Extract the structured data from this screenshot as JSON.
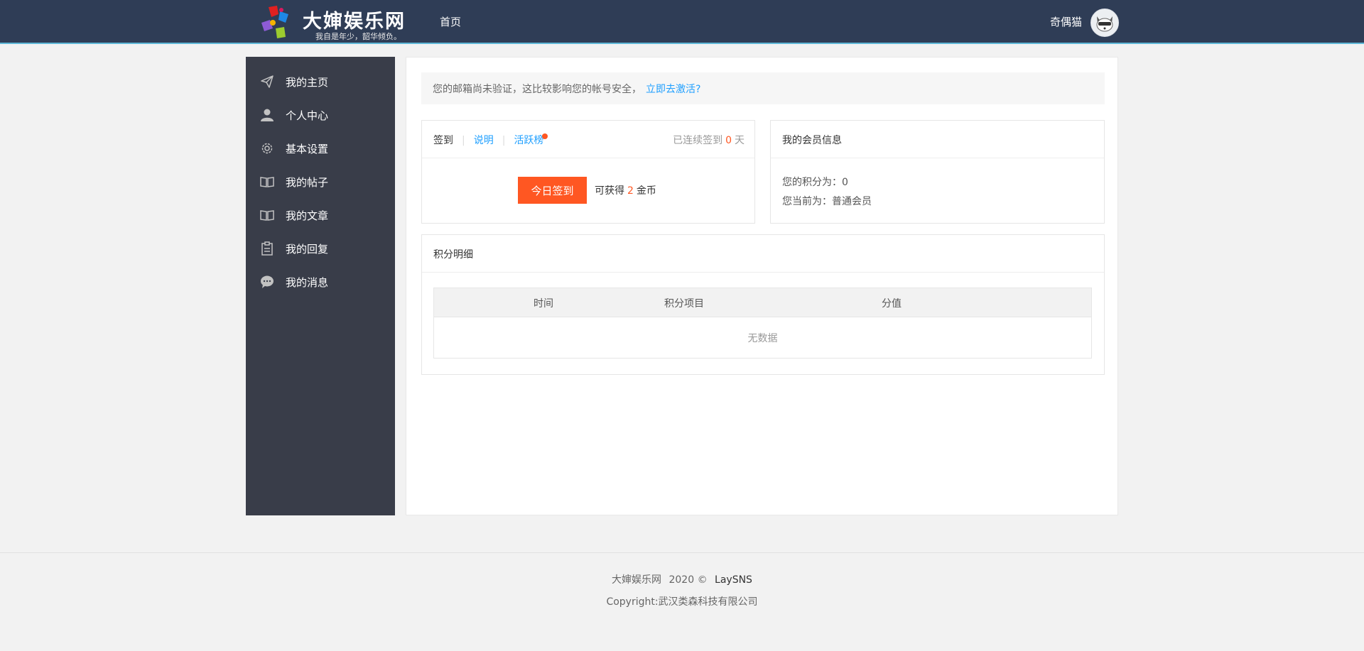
{
  "header": {
    "site_name": "大婶娱乐网",
    "slogan": "我自是年少，韶华倾负。",
    "nav_home": "首页",
    "username": "奇偶猫"
  },
  "sidebar": {
    "items": [
      {
        "label": "我的主页",
        "icon": "paper-plane-icon"
      },
      {
        "label": "个人中心",
        "icon": "user-icon"
      },
      {
        "label": "基本设置",
        "icon": "gear-icon"
      },
      {
        "label": "我的帖子",
        "icon": "book-icon"
      },
      {
        "label": "我的文章",
        "icon": "book-icon"
      },
      {
        "label": "我的回复",
        "icon": "clipboard-icon"
      },
      {
        "label": "我的消息",
        "icon": "chat-icon"
      }
    ]
  },
  "notice": {
    "text": "您的邮箱尚未验证，这比较影响您的帐号安全，",
    "link": "立即去激活?"
  },
  "signin": {
    "tab_sign": "签到",
    "tab_explain": "说明",
    "tab_rank": "活跃榜",
    "streak_prefix": "已连续签到",
    "streak_days": "0",
    "streak_suffix": "天",
    "button": "今日签到",
    "reward_prefix": "可获得",
    "reward_amount": "2",
    "reward_suffix": "金币"
  },
  "member": {
    "title": "我的会员信息",
    "points_line": "您的积分为：0",
    "level_line": "您当前为：普通会员"
  },
  "points_detail": {
    "title": "积分明细",
    "columns": [
      "时间",
      "积分项目",
      "分值"
    ],
    "empty": "无数据"
  },
  "footer": {
    "site": "大婶娱乐网",
    "year": "2020 ©",
    "brand": "LaySNS",
    "copyright": "Copyright:武汉类森科技有限公司"
  },
  "colors": {
    "header_bg": "#2f3d56",
    "sidebar_bg": "#393d49",
    "accent": "#ff5722",
    "link": "#1e9fff"
  }
}
